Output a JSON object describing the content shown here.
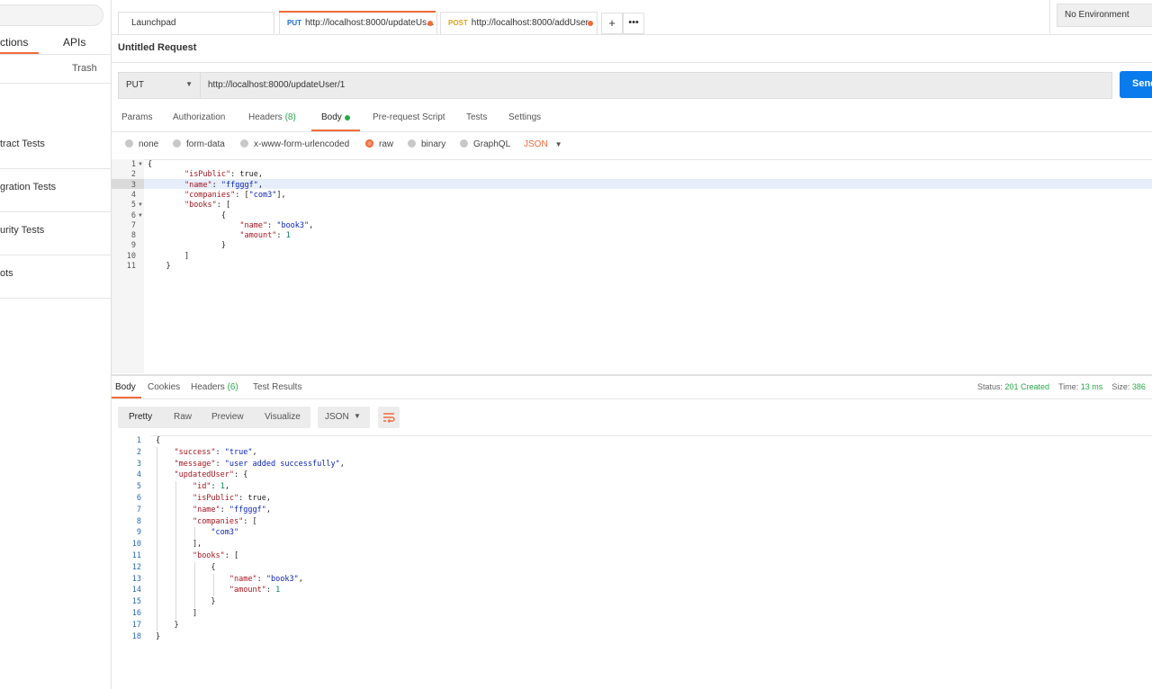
{
  "sidebar": {
    "tabs": [
      "ctions",
      "APIs"
    ],
    "trash_label": "Trash",
    "items": [
      "tract Tests",
      "gration Tests",
      "urity Tests",
      "ots"
    ]
  },
  "request_tabs": {
    "launchpad": "Launchpad",
    "tab2_method": "PUT",
    "tab2_url": "http://localhost:8000/updateUs...",
    "tab3_method": "POST",
    "tab3_url": "http://localhost:8000/addUser",
    "add_icon": "plus-icon",
    "more_icon": "ellipsis-icon"
  },
  "environment": "No Environment",
  "request": {
    "title": "Untitled Request",
    "method": "PUT",
    "url": "http://localhost:8000/updateUser/1",
    "send_label": "Send"
  },
  "request_subtabs": {
    "params": "Params",
    "authorization": "Authorization",
    "headers": "Headers",
    "headers_count": "(8)",
    "body": "Body",
    "prerequest": "Pre-request Script",
    "tests": "Tests",
    "settings": "Settings"
  },
  "body_modes": {
    "none": "none",
    "form_data": "form-data",
    "urlencoded": "x-www-form-urlencoded",
    "raw": "raw",
    "binary": "binary",
    "graphql": "GraphQL",
    "language": "JSON",
    "selected": "raw"
  },
  "request_body_lines": [
    "{",
    "        \"isPublic\": true,",
    "        \"name\": \"ffgggf\",",
    "        \"companies\": [\"com3\"],",
    "        \"books\": [",
    "                {",
    "                    \"name\": \"book3\",",
    "                    \"amount\": 1",
    "                }",
    "        ]",
    "    }"
  ],
  "response_tabs": {
    "body": "Body",
    "cookies": "Cookies",
    "headers": "Headers",
    "headers_count": "(6)",
    "test_results": "Test Results"
  },
  "response_meta": {
    "status_label": "Status:",
    "status_value": "201 Created",
    "time_label": "Time:",
    "time_value": "13 ms",
    "size_label": "Size:",
    "size_value": "386"
  },
  "response_view": {
    "pretty": "Pretty",
    "raw": "Raw",
    "preview": "Preview",
    "visualize": "Visualize",
    "format": "JSON",
    "wrap_icon": "wrap-lines-icon"
  },
  "response_body_lines": [
    "{",
    "    \"success\": \"true\",",
    "    \"message\": \"user added successfully\",",
    "    \"updatedUser\": {",
    "        \"id\": 1,",
    "        \"isPublic\": true,",
    "        \"name\": \"ffgggf\",",
    "        \"companies\": [",
    "            \"com3\"",
    "        ],",
    "        \"books\": [",
    "            {",
    "                \"name\": \"book3\",",
    "                \"amount\": 1",
    "            }",
    "        ]",
    "    }",
    "}"
  ],
  "colors": {
    "accent": "#f26b3a",
    "send": "#097bed",
    "success": "#2ba94c",
    "json_key": "#a3151f",
    "json_string": "#0b24b6"
  }
}
